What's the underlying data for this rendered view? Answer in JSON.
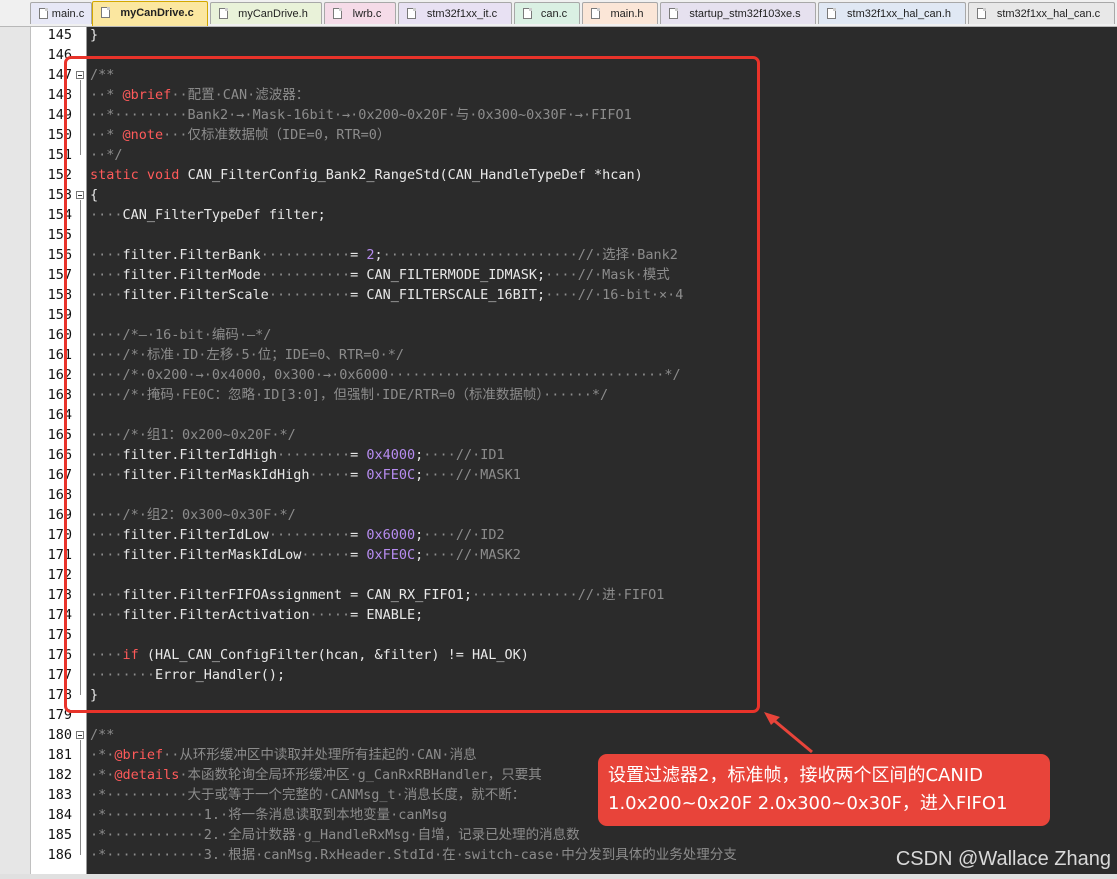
{
  "tabs": [
    {
      "label": "main.c",
      "color": "#e7e8f6",
      "active": false
    },
    {
      "label": "myCanDrive.c",
      "color": "#fbe7a0",
      "active": true
    },
    {
      "label": "myCanDrive.h",
      "color": "#e9f2d9",
      "active": false
    },
    {
      "label": "lwrb.c",
      "color": "#f5dbe8",
      "active": false
    },
    {
      "label": "stm32f1xx_it.c",
      "color": "#e8e1f3",
      "active": false
    },
    {
      "label": "can.c",
      "color": "#daf0e3",
      "active": false
    },
    {
      "label": "main.h",
      "color": "#fbe6d7",
      "active": false
    },
    {
      "label": "startup_stm32f103xe.s",
      "color": "#e6e1ef",
      "active": false
    },
    {
      "label": "stm32f1xx_hal_can.h",
      "color": "#e0e8f4",
      "active": false
    },
    {
      "label": "stm32f1xx_hal_can.c",
      "color": "#e8e8e8",
      "active": false
    }
  ],
  "lines": [
    {
      "num": "145",
      "segs": [
        [
          "p",
          "}"
        ]
      ]
    },
    {
      "num": "146",
      "segs": []
    },
    {
      "num": "147",
      "fold": true,
      "segs": [
        [
          "c",
          "/**"
        ]
      ]
    },
    {
      "num": "148",
      "segs": [
        [
          "d",
          "··"
        ],
        [
          "c",
          "* "
        ],
        [
          "k",
          "@brief"
        ],
        [
          "c",
          "··配置·CAN·滤波器："
        ]
      ]
    },
    {
      "num": "149",
      "segs": [
        [
          "d",
          "··"
        ],
        [
          "c",
          "*·········Bank2·→·Mask-16bit·→·0x200~0x20F·与·0x300~0x30F·→·FIFO1"
        ]
      ]
    },
    {
      "num": "150",
      "segs": [
        [
          "d",
          "··"
        ],
        [
          "c",
          "* "
        ],
        [
          "k",
          "@note"
        ],
        [
          "c",
          "···仅标准数据帧（IDE=0，RTR=0）"
        ]
      ]
    },
    {
      "num": "151",
      "segs": [
        [
          "d",
          "··"
        ],
        [
          "c",
          "*/"
        ]
      ]
    },
    {
      "num": "152",
      "segs": [
        [
          "k",
          "static"
        ],
        [
          "p",
          " "
        ],
        [
          "k",
          "void"
        ],
        [
          "p",
          " CAN_FilterConfig_Bank2_RangeStd(CAN_HandleTypeDef *hcan)"
        ]
      ]
    },
    {
      "num": "153",
      "fold": true,
      "segs": [
        [
          "p",
          "{"
        ]
      ]
    },
    {
      "num": "154",
      "segs": [
        [
          "d",
          "····"
        ],
        [
          "p",
          "CAN_FilterTypeDef filter;"
        ]
      ]
    },
    {
      "num": "155",
      "segs": []
    },
    {
      "num": "156",
      "segs": [
        [
          "d",
          "····"
        ],
        [
          "p",
          "filter.FilterBank"
        ],
        [
          "d",
          "···········"
        ],
        [
          "p",
          "= "
        ],
        [
          "n",
          "2"
        ],
        [
          "p",
          ";"
        ],
        [
          "d",
          "························"
        ],
        [
          "c",
          "//·选择·Bank2"
        ]
      ]
    },
    {
      "num": "157",
      "segs": [
        [
          "d",
          "····"
        ],
        [
          "p",
          "filter.FilterMode"
        ],
        [
          "d",
          "···········"
        ],
        [
          "p",
          "= CAN_FILTERMODE_IDMASK;"
        ],
        [
          "d",
          "····"
        ],
        [
          "c",
          "//·Mask·模式"
        ]
      ]
    },
    {
      "num": "158",
      "segs": [
        [
          "d",
          "····"
        ],
        [
          "p",
          "filter.FilterScale"
        ],
        [
          "d",
          "··········"
        ],
        [
          "p",
          "= CAN_FILTERSCALE_16BIT;"
        ],
        [
          "d",
          "····"
        ],
        [
          "c",
          "//·16-bit·×·4"
        ]
      ]
    },
    {
      "num": "159",
      "segs": []
    },
    {
      "num": "160",
      "segs": [
        [
          "d",
          "····"
        ],
        [
          "c",
          "/*—·16-bit·编码·—*/"
        ]
      ]
    },
    {
      "num": "161",
      "segs": [
        [
          "d",
          "····"
        ],
        [
          "c",
          "/*·标准·ID·左移·5·位；IDE=0、RTR=0·*/"
        ]
      ]
    },
    {
      "num": "162",
      "segs": [
        [
          "d",
          "····"
        ],
        [
          "c",
          "/*·0x200·→·0x4000，0x300·→·0x6000··································*/"
        ]
      ]
    },
    {
      "num": "163",
      "segs": [
        [
          "d",
          "····"
        ],
        [
          "c",
          "/*·掩码·FE0C：忽略·ID[3:0]，但强制·IDE/RTR=0（标准数据帧）······*/"
        ]
      ]
    },
    {
      "num": "164",
      "segs": []
    },
    {
      "num": "165",
      "segs": [
        [
          "d",
          "····"
        ],
        [
          "c",
          "/*·组1：0x200~0x20F·*/"
        ]
      ]
    },
    {
      "num": "166",
      "segs": [
        [
          "d",
          "····"
        ],
        [
          "p",
          "filter.FilterIdHigh"
        ],
        [
          "d",
          "·········"
        ],
        [
          "p",
          "= "
        ],
        [
          "n",
          "0x4000"
        ],
        [
          "p",
          ";"
        ],
        [
          "d",
          "····"
        ],
        [
          "c",
          "//·ID1"
        ]
      ]
    },
    {
      "num": "167",
      "segs": [
        [
          "d",
          "····"
        ],
        [
          "p",
          "filter.FilterMaskIdHigh"
        ],
        [
          "d",
          "·····"
        ],
        [
          "p",
          "= "
        ],
        [
          "n",
          "0xFE0C"
        ],
        [
          "p",
          ";"
        ],
        [
          "d",
          "····"
        ],
        [
          "c",
          "//·MASK1"
        ]
      ]
    },
    {
      "num": "168",
      "segs": []
    },
    {
      "num": "169",
      "segs": [
        [
          "d",
          "····"
        ],
        [
          "c",
          "/*·组2：0x300~0x30F·*/"
        ]
      ]
    },
    {
      "num": "170",
      "segs": [
        [
          "d",
          "····"
        ],
        [
          "p",
          "filter.FilterIdLow"
        ],
        [
          "d",
          "··········"
        ],
        [
          "p",
          "= "
        ],
        [
          "n",
          "0x6000"
        ],
        [
          "p",
          ";"
        ],
        [
          "d",
          "····"
        ],
        [
          "c",
          "//·ID2"
        ]
      ]
    },
    {
      "num": "171",
      "segs": [
        [
          "d",
          "····"
        ],
        [
          "p",
          "filter.FilterMaskIdLow"
        ],
        [
          "d",
          "······"
        ],
        [
          "p",
          "= "
        ],
        [
          "n",
          "0xFE0C"
        ],
        [
          "p",
          ";"
        ],
        [
          "d",
          "····"
        ],
        [
          "c",
          "//·MASK2"
        ]
      ]
    },
    {
      "num": "172",
      "segs": []
    },
    {
      "num": "173",
      "segs": [
        [
          "d",
          "····"
        ],
        [
          "p",
          "filter.FilterFIFOAssignment = CAN_RX_FIFO1;"
        ],
        [
          "d",
          "·············"
        ],
        [
          "c",
          "//·进·FIFO1"
        ]
      ]
    },
    {
      "num": "174",
      "segs": [
        [
          "d",
          "····"
        ],
        [
          "p",
          "filter.FilterActivation"
        ],
        [
          "d",
          "·····"
        ],
        [
          "p",
          "= ENABLE;"
        ]
      ]
    },
    {
      "num": "175",
      "segs": []
    },
    {
      "num": "176",
      "segs": [
        [
          "d",
          "····"
        ],
        [
          "k",
          "if"
        ],
        [
          "p",
          " (HAL_CAN_ConfigFilter(hcan, &filter) != HAL_OK)"
        ]
      ]
    },
    {
      "num": "177",
      "segs": [
        [
          "d",
          "········"
        ],
        [
          "p",
          "Error_Handler();"
        ]
      ]
    },
    {
      "num": "178",
      "segs": [
        [
          "p",
          "}"
        ]
      ]
    },
    {
      "num": "179",
      "segs": []
    },
    {
      "num": "180",
      "fold": true,
      "segs": [
        [
          "c",
          "/**"
        ]
      ]
    },
    {
      "num": "181",
      "segs": [
        [
          "c",
          "·*·"
        ],
        [
          "k",
          "@brief"
        ],
        [
          "c",
          "··从环形缓冲区中读取并处理所有挂起的·CAN·消息"
        ]
      ]
    },
    {
      "num": "182",
      "segs": [
        [
          "c",
          "·*·"
        ],
        [
          "k",
          "@details"
        ],
        [
          "c",
          "·本函数轮询全局环形缓冲区·g_CanRxRBHandler，只要其"
        ]
      ]
    },
    {
      "num": "183",
      "segs": [
        [
          "c",
          "·*··········大于或等于一个完整的·CANMsg_t·消息长度，就不断："
        ]
      ]
    },
    {
      "num": "184",
      "segs": [
        [
          "c",
          "·*············1.·将一条消息读取到本地变量·canMsg"
        ]
      ]
    },
    {
      "num": "185",
      "segs": [
        [
          "c",
          "·*············2.·全局计数器·g_HandleRxMsg·自增，记录已处理的消息数"
        ]
      ]
    },
    {
      "num": "186",
      "segs": [
        [
          "c",
          "·*············3.·根据·canMsg.RxHeader.StdId·在·switch-case·中分发到具体的业务处理分支"
        ]
      ]
    }
  ],
  "callout": {
    "line1": "设置过滤器2，标准帧，接收两个区间的CANID",
    "line2": "1.0x200~0x20F  2.0x300~0x30F，进入FIFO1"
  },
  "watermark": "CSDN @Wallace Zhang",
  "colors": {
    "keyword": "#ff5a5a",
    "comment": "#8c8c8c",
    "number": "#b78cf0",
    "highlight": "#e8332a",
    "callout": "#e8443a"
  }
}
